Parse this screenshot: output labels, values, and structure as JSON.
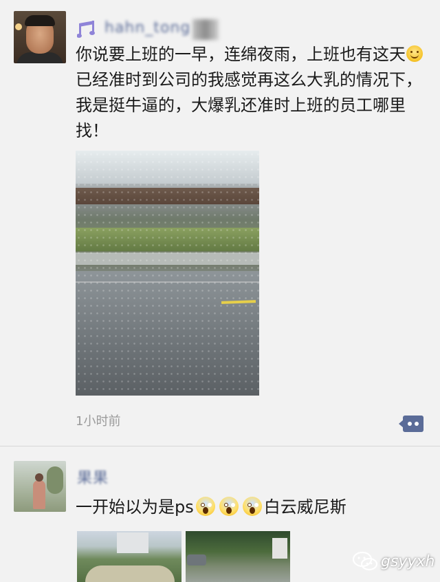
{
  "post1": {
    "username": "hahn_tong",
    "text_before_emoji": "你说要上班的一早，连绵夜雨，上班也有这天",
    "text_after_emoji": "已经准时到公司的我感觉再这么大乳的情况下，我是挺牛逼的，大爆乳还准时上班的员工哪里找！",
    "timestamp": "1小时前"
  },
  "post2": {
    "username": "果果",
    "text_before_emoji": "一开始以为是ps",
    "text_after_emoji": "白云威尼斯"
  },
  "watermark": {
    "text": "gsyyxh"
  },
  "icons": {
    "music": "music-note-icon",
    "comment": "comment-dots-icon",
    "smile": "smile-emoji",
    "scream": "scream-emoji",
    "wechat": "wechat-icon"
  },
  "colors": {
    "username": "#5b6c98",
    "background": "#f2f2f2",
    "text": "#1a1a1a",
    "timestamp": "#9a9a9a",
    "comment_button": "#5b6c98"
  }
}
